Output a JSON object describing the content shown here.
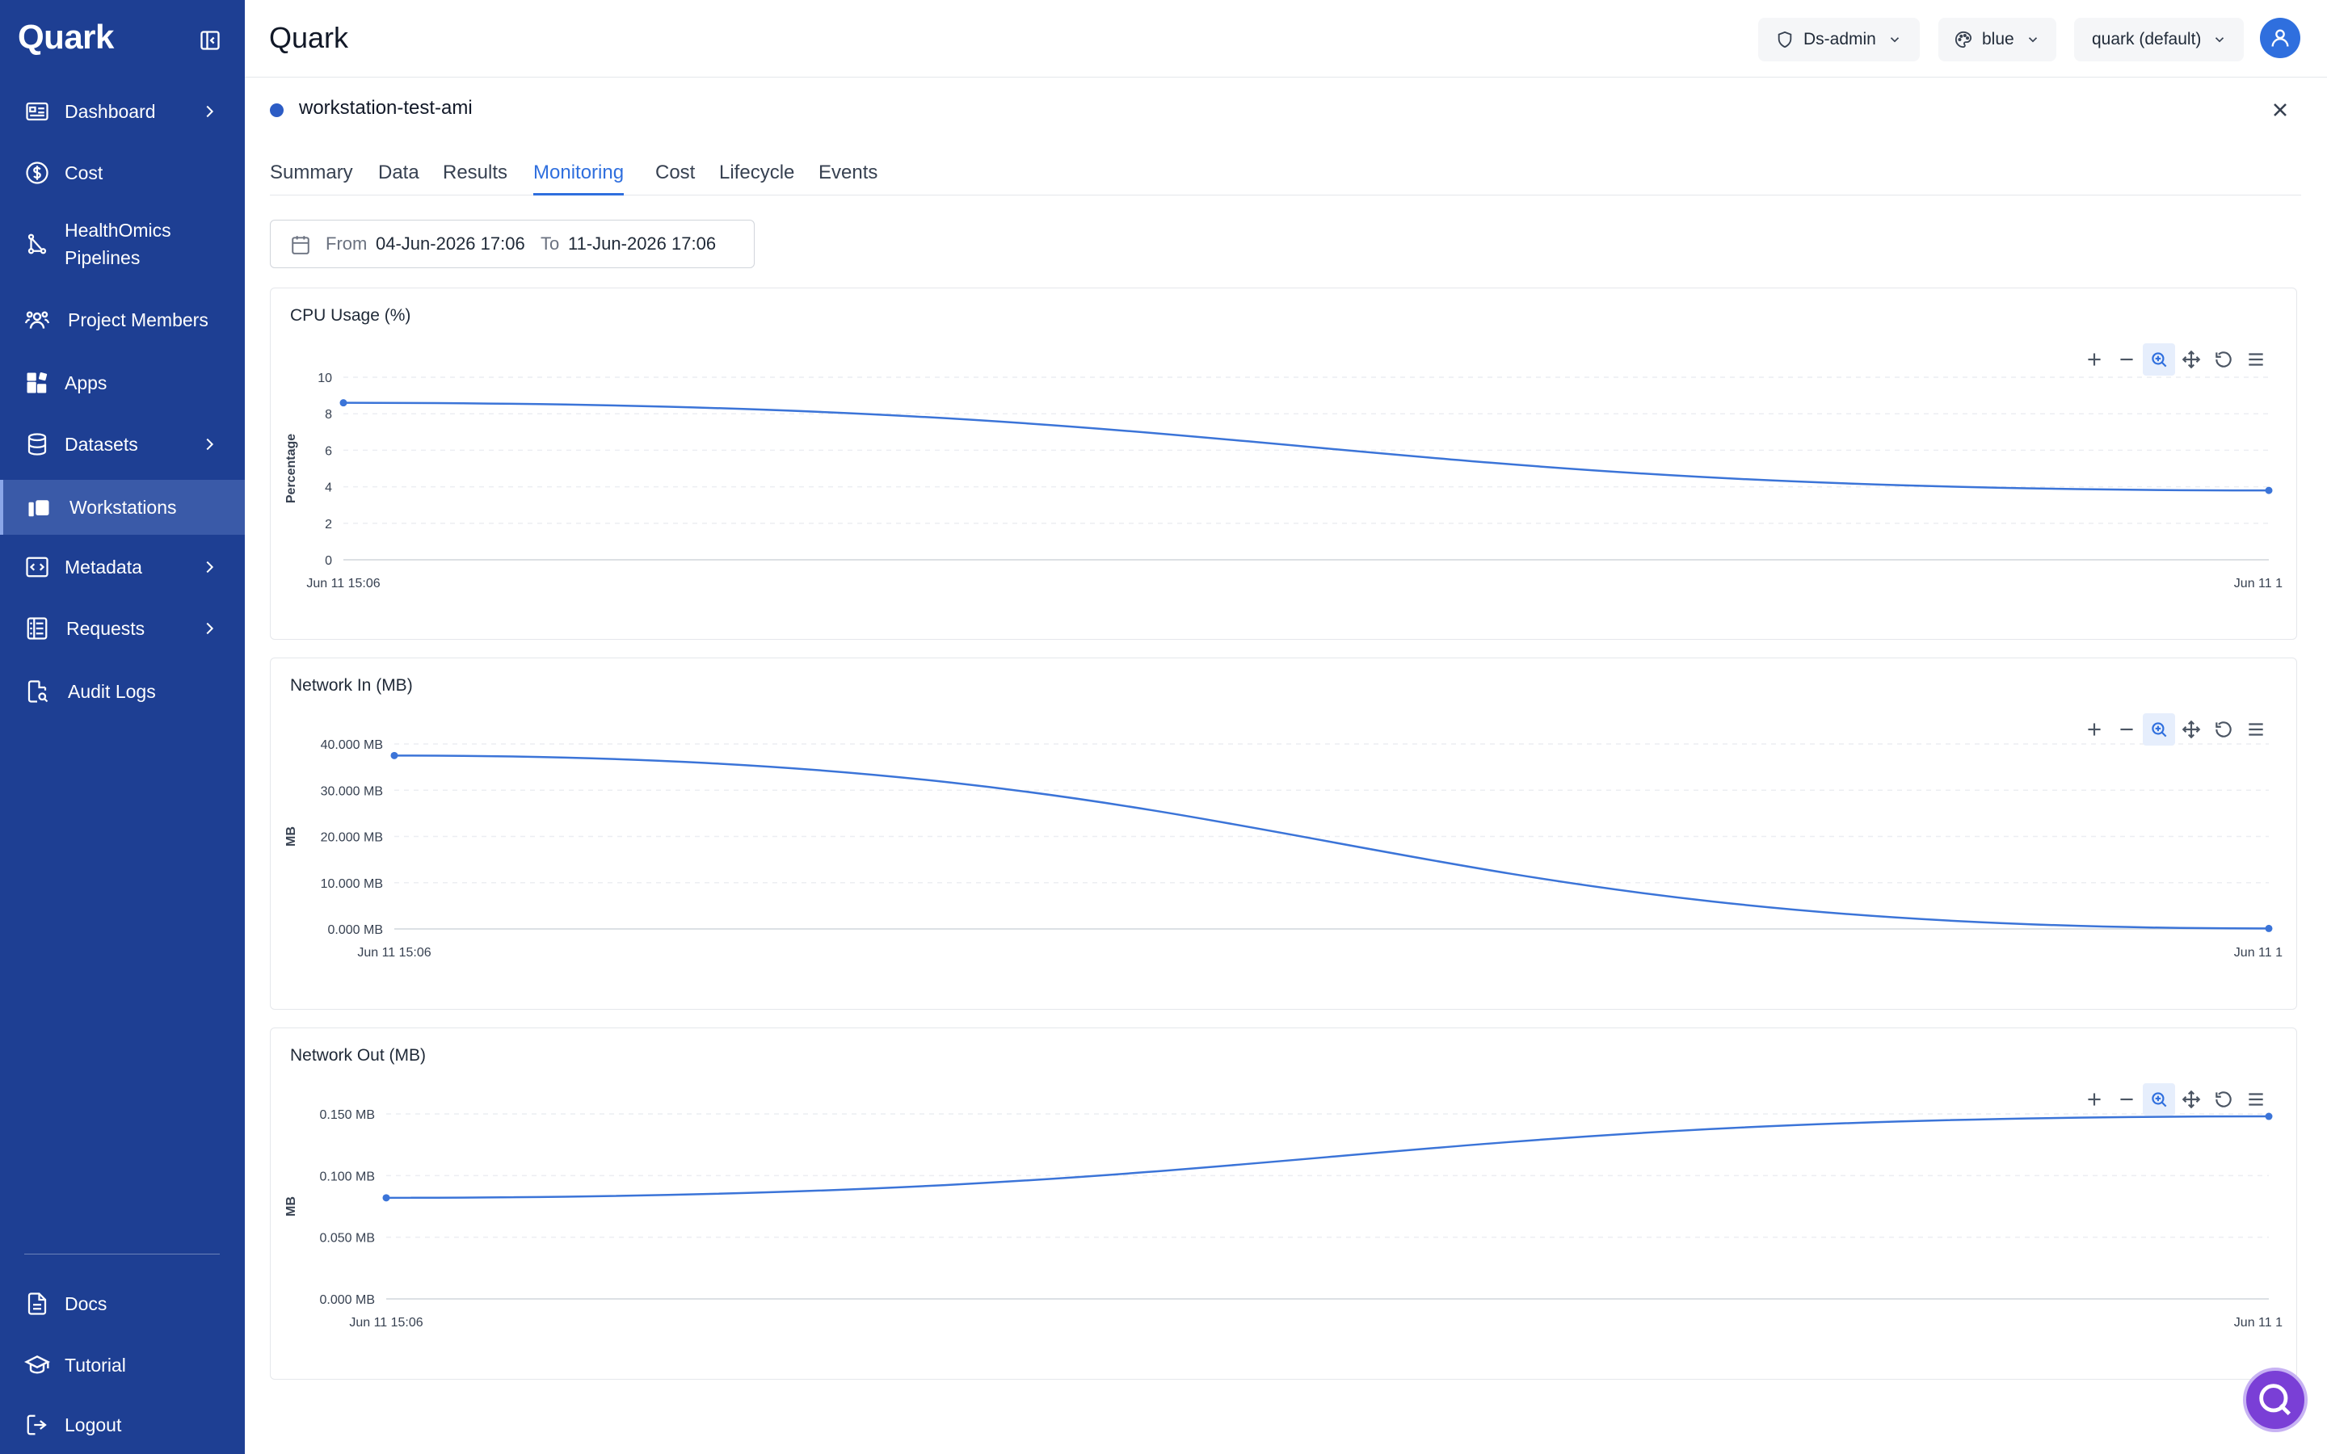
{
  "app": {
    "brand": "Quark"
  },
  "sidebar": {
    "items": [
      {
        "label": "Dashboard",
        "icon": "dashboard-icon"
      },
      {
        "label": "Cost",
        "icon": "dollar-icon"
      },
      {
        "label": "HealthOmics\nPipelines",
        "line1": "HealthOmics",
        "line2": "Pipelines",
        "icon": "pipeline-icon"
      },
      {
        "label": "Project Members",
        "icon": "users-icon"
      },
      {
        "label": "Apps",
        "icon": "apps-icon"
      },
      {
        "label": "Datasets",
        "icon": "database-icon"
      },
      {
        "label": "Workstations",
        "icon": "workstation-icon"
      },
      {
        "label": "Metadata",
        "icon": "code-icon"
      },
      {
        "label": "Requests",
        "icon": "list-icon"
      },
      {
        "label": "Audit Logs",
        "icon": "audit-icon"
      },
      {
        "label": "Docs",
        "icon": "doc-icon"
      },
      {
        "label": "Tutorial",
        "icon": "graduation-cap-icon"
      },
      {
        "label": "Logout",
        "icon": "logout-icon"
      }
    ]
  },
  "header": {
    "title": "Quark",
    "role": "Ds-admin",
    "theme": "blue",
    "project": "quark (default)"
  },
  "resource": {
    "name": "workstation-test-ami",
    "status_color": "#2c5cc5"
  },
  "tabs": [
    "Summary",
    "Data",
    "Results",
    "Monitoring",
    "Cost",
    "Lifecycle",
    "Events"
  ],
  "active_tab": "Monitoring",
  "daterange": {
    "from_label": "From",
    "from": "04-Jun-2026 17:06",
    "to_label": "To",
    "to": "11-Jun-2026 17:06"
  },
  "colors": {
    "sidebar": "#1e3f93",
    "accent": "#2f6fde",
    "series": "#3b74d8"
  },
  "chart_data": [
    {
      "type": "line",
      "title": "CPU Usage (%)",
      "ylabel": "Percentage",
      "yticks": [
        "0",
        "2",
        "4",
        "6",
        "8",
        "10"
      ],
      "ylim": [
        0,
        10
      ],
      "xticks": [
        "Jun 11 15:06",
        "Jun 11 1"
      ],
      "series": [
        {
          "values": [
            8.6,
            3.8
          ]
        }
      ]
    },
    {
      "type": "line",
      "title": "Network In (MB)",
      "ylabel": "MB",
      "yticks": [
        "0.000 MB",
        "10.000 MB",
        "20.000 MB",
        "30.000 MB",
        "40.000 MB"
      ],
      "ylim": [
        0,
        40
      ],
      "xticks": [
        "Jun 11 15:06",
        "Jun 11 1"
      ],
      "series": [
        {
          "values": [
            37.5,
            0.1
          ]
        }
      ]
    },
    {
      "type": "line",
      "title": "Network Out (MB)",
      "ylabel": "MB",
      "yticks": [
        "0.000 MB",
        "0.050 MB",
        "0.100 MB",
        "0.150 MB"
      ],
      "ylim": [
        0,
        0.15
      ],
      "xticks": [
        "Jun 11 15:06",
        "Jun 11 1"
      ],
      "series": [
        {
          "values": [
            0.082,
            0.148
          ]
        }
      ]
    }
  ]
}
